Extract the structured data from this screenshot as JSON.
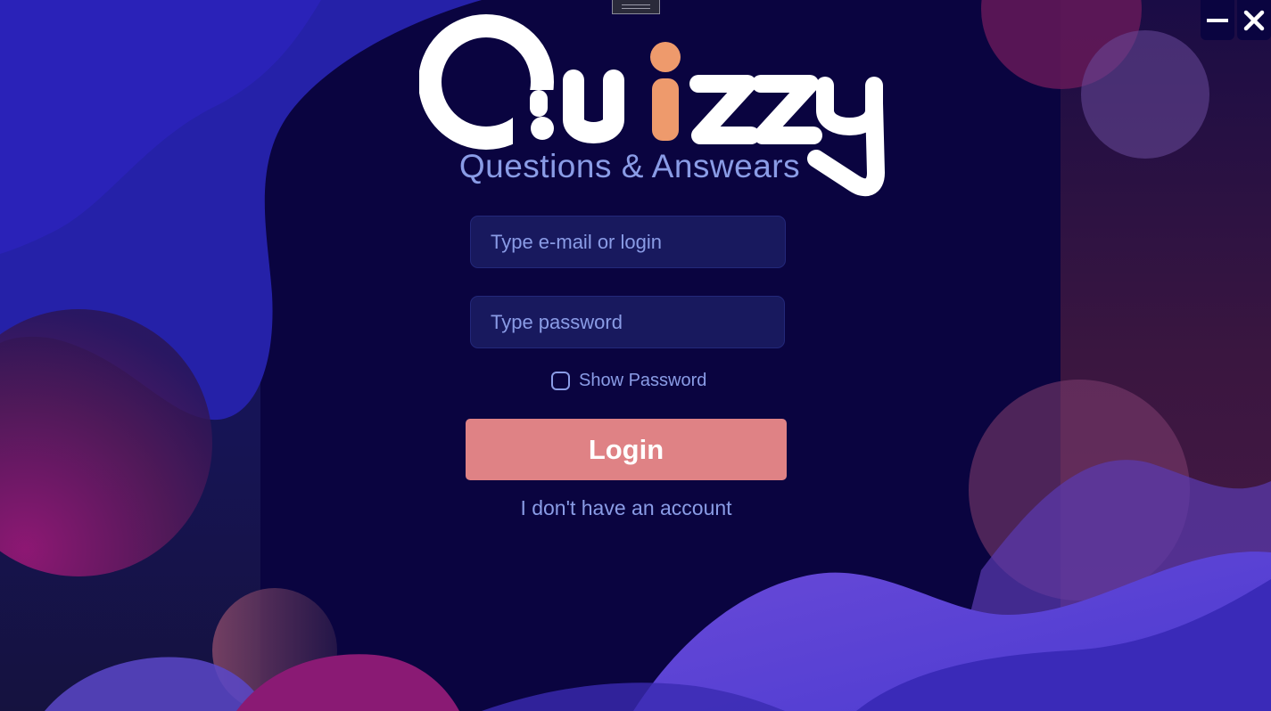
{
  "app": {
    "logo_text": "Quizzy",
    "subtitle": "Questions & Answears"
  },
  "window_controls": {
    "minimize_icon": "minimize-icon",
    "close_icon": "close-icon"
  },
  "login_form": {
    "email_placeholder": "Type e-mail or login",
    "email_value": "",
    "password_placeholder": "Type password",
    "password_value": "",
    "show_password_label": "Show Password",
    "show_password_checked": false,
    "login_label": "Login",
    "no_account_label": "I don't have an account"
  },
  "colors": {
    "background": "#0a0440",
    "field_background": "#18195e",
    "accent_text": "#8a9ce6",
    "login_button": "#df8285",
    "logo_i_accent": "#ee9a6c"
  }
}
